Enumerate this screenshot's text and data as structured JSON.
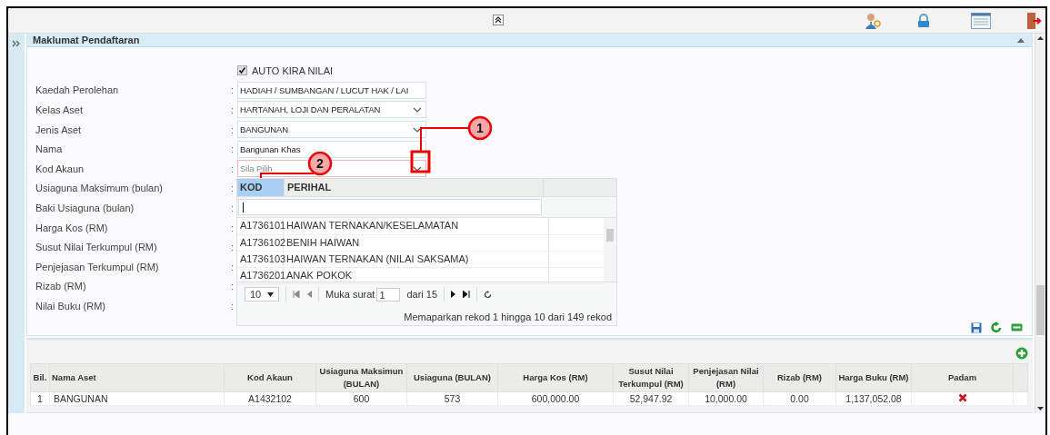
{
  "panel": {
    "title": "Maklumat Pendaftaran"
  },
  "auto_calc": {
    "label": "AUTO KIRA NILAI",
    "checked": true
  },
  "fields": [
    {
      "label": "Kaedah Perolehan",
      "separator": ":",
      "kind": "text",
      "value": "HADIAH / SUMBANGAN / LUCUT HAK / LAI"
    },
    {
      "label": "Kelas Aset",
      "separator": ":",
      "kind": "select",
      "value": "HARTANAH, LOJI DAN PERALATAN"
    },
    {
      "label": "Jenis Aset",
      "separator": ":",
      "kind": "select",
      "value": "BANGUNAN"
    },
    {
      "label": "Nama",
      "separator": ":",
      "kind": "text",
      "value": "Bangunan Khas"
    },
    {
      "label": "Kod Akaun",
      "separator": ":",
      "kind": "lookup",
      "placeholder": "Sila Pilih",
      "invalid": true
    },
    {
      "label": "Usiaguna Maksimum (bulan)",
      "separator": ":",
      "kind": "covered"
    },
    {
      "label": "Baki Usiaguna (bulan)",
      "separator": ":",
      "kind": "covered"
    },
    {
      "label": "Harga Kos (RM)",
      "separator": ":",
      "kind": "covered"
    },
    {
      "label": "Susut Nilai Terkumpul (RM)",
      "separator": ":",
      "kind": "covered"
    },
    {
      "label": "Penjejasan Terkumpul (RM)",
      "separator": ":",
      "kind": "covered"
    },
    {
      "label": "Rizab (RM)",
      "separator": ":",
      "kind": "covered"
    },
    {
      "label": "Nilai Buku (RM)",
      "separator": ":",
      "kind": "covered"
    }
  ],
  "lookup": {
    "columns": [
      {
        "label": "KOD",
        "selected": true
      },
      {
        "label": "PERIHAL",
        "selected": false
      }
    ],
    "filter_focused": true,
    "rows": [
      {
        "kod": "A1736101",
        "perihal": "HAIWAN TERNAKAN/KESELAMATAN"
      },
      {
        "kod": "A1736102",
        "perihal": "BENIH HAIWAN"
      },
      {
        "kod": "A1736103",
        "perihal": "HAIWAN TERNAKAN (NILAI SAKSAMA)"
      },
      {
        "kod": "A1736201",
        "perihal": "ANAK POKOK"
      }
    ],
    "pager": {
      "page_size": "10",
      "page_label": "Muka surat",
      "page": "1",
      "total": "dari 15",
      "summary": "Memaparkan rekod 1 hingga 10 dari 149 rekod"
    }
  },
  "table": {
    "columns": [
      "Bil.",
      "Nama Aset",
      "Kod Akaun",
      "Usiaguna Maksimun (BULAN)",
      "Usiaguna (BULAN)",
      "Harga Kos (RM)",
      "Susut Nilai Terkumpul (RM)",
      "Penjejasan Nilai (RM)",
      "Rizab (RM)",
      "Harga Buku (RM)",
      "Padam"
    ],
    "rows": [
      {
        "cells": [
          "1",
          "BANGUNAN",
          "A1432102",
          "600",
          "573",
          "600,000.00",
          "52,947.92",
          "10,000.00",
          "0.00",
          "1,137,052.08"
        ],
        "deletable": true
      }
    ]
  },
  "callouts": [
    {
      "number": "1"
    },
    {
      "number": "2"
    }
  ]
}
